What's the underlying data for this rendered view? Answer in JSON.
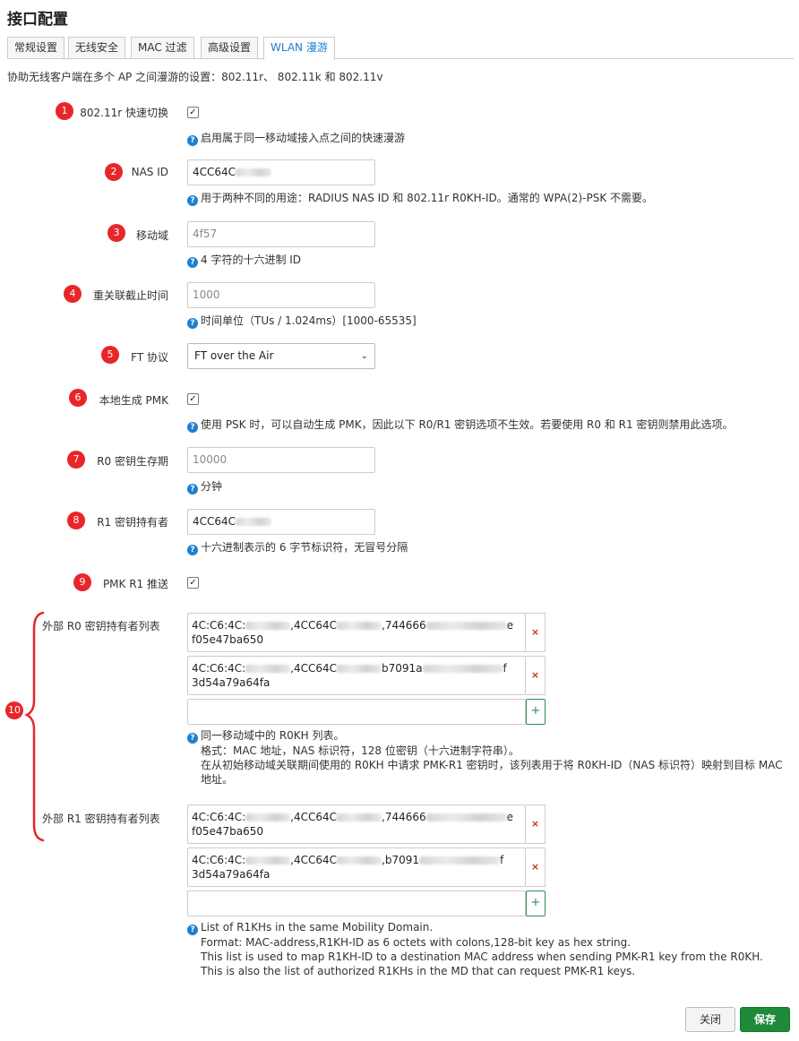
{
  "page": {
    "title": "接口配置",
    "description": "协助无线客户端在多个 AP 之间漫游的设置：802.11r、 802.11k 和 802.11v"
  },
  "tabs": [
    {
      "label": "常规设置",
      "active": false
    },
    {
      "label": "无线安全",
      "active": false
    },
    {
      "label": "MAC 过滤",
      "active": false
    },
    {
      "label": "高级设置",
      "active": false
    },
    {
      "label": "WLAN 漫游",
      "active": true
    }
  ],
  "badges": [
    "1",
    "2",
    "3",
    "4",
    "5",
    "6",
    "7",
    "8",
    "9",
    "10"
  ],
  "fields": {
    "ft": {
      "label": "802.11r 快速切换",
      "checked": true,
      "help": "启用属于同一移动域接入点之间的快速漫游"
    },
    "nasid": {
      "label": "NAS ID",
      "value": "4CC64C",
      "help": "用于两种不同的用途：RADIUS NAS ID 和 802.11r R0KH-ID。通常的 WPA(2)-PSK 不需要。"
    },
    "mobility": {
      "label": "移动域",
      "placeholder": "4f57",
      "help": "4 字符的十六进制 ID"
    },
    "reassoc": {
      "label": "重关联截止时间",
      "placeholder": "1000",
      "help": "时间单位（TUs / 1.024ms）[1000-65535]"
    },
    "ftproto": {
      "label": "FT 协议",
      "value": "FT over the Air"
    },
    "pmk_local": {
      "label": "本地生成 PMK",
      "checked": true,
      "help": "使用 PSK 时，可以自动生成 PMK，因此以下 R0/R1 密钥选项不生效。若要使用 R0 和 R1 密钥则禁用此选项。"
    },
    "r0_lifetime": {
      "label": "R0 密钥生存期",
      "placeholder": "10000",
      "help": "分钟"
    },
    "r1_holder": {
      "label": "R1 密钥持有者",
      "value": "4CC64C",
      "help": "十六进制表示的 6 字节标识符，无冒号分隔"
    },
    "pmk_r1_push": {
      "label": "PMK R1 推送",
      "checked": true
    }
  },
  "r0kh": {
    "label": "外部 R0 密钥持有者列表",
    "entries": [
      {
        "a": "4C:C6:4C:",
        "b": ",4CC64C",
        "c": ",744666",
        "d": "e",
        "line2": "f05e47ba650"
      },
      {
        "a": "4C:C6:4C:",
        "b": ",4CC64C",
        "c": "b7091a",
        "d": "f",
        "line2": "3d54a79a64fa"
      }
    ],
    "help": [
      "同一移动域中的 R0KH 列表。",
      "格式：MAC 地址，NAS 标识符，128 位密钥（十六进制字符串）。",
      "在从初始移动域关联期间使用的 R0KH 中请求 PMK-R1 密钥时，该列表用于将 R0KH-ID（NAS 标识符）映射到目标 MAC 地址。"
    ]
  },
  "r1kh": {
    "label": "外部 R1 密钥持有者列表",
    "entries": [
      {
        "a": "4C:C6:4C:",
        "b": ",4CC64C",
        "c": ",744666",
        "d": "e",
        "line2": "f05e47ba650"
      },
      {
        "a": "4C:C6:4C:",
        "b": ",4CC64C",
        "c": ",b7091",
        "d": "f",
        "line2": "3d54a79a64fa"
      }
    ],
    "help": [
      "List of R1KHs in the same Mobility Domain.",
      "Format: MAC-address,R1KH-ID as 6 octets with colons,128-bit key as hex string.",
      "This list is used to map R1KH-ID to a destination MAC address when sending PMK-R1 key from the R0KH. This is also the list of authorized R1KHs in the MD that can request PMK-R1 keys."
    ]
  },
  "icons": {
    "check": "✓",
    "remove": "×",
    "add": "+",
    "help": "?",
    "dropdown": "⌄"
  },
  "buttons": {
    "close": "关闭",
    "save": "保存"
  },
  "colors": {
    "accent": "#1e7fd1",
    "badge": "#e8262a",
    "save": "#1f8a3a",
    "remove": "#c0332a"
  }
}
